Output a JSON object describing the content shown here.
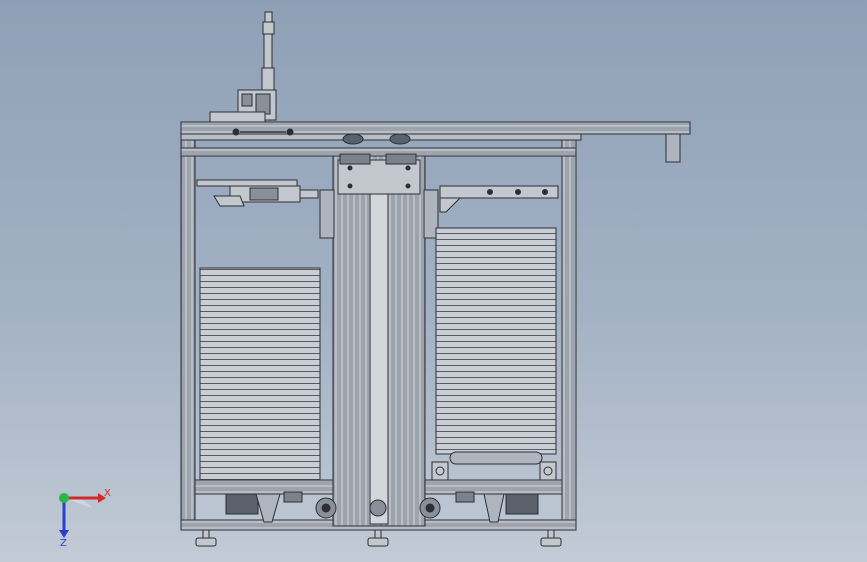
{
  "viewport": {
    "background_top": "#8fa0b6",
    "background_bottom": "#c2cbd6",
    "line_color": "#2b2f36",
    "metal_color": "#aeb5bf",
    "dark_metal": "#5a616b"
  },
  "triad": {
    "x_label": "X",
    "z_label": "Z",
    "x_color": "#d22a2a",
    "y_color": "#2bb54a",
    "z_color": "#2a3fd2"
  }
}
